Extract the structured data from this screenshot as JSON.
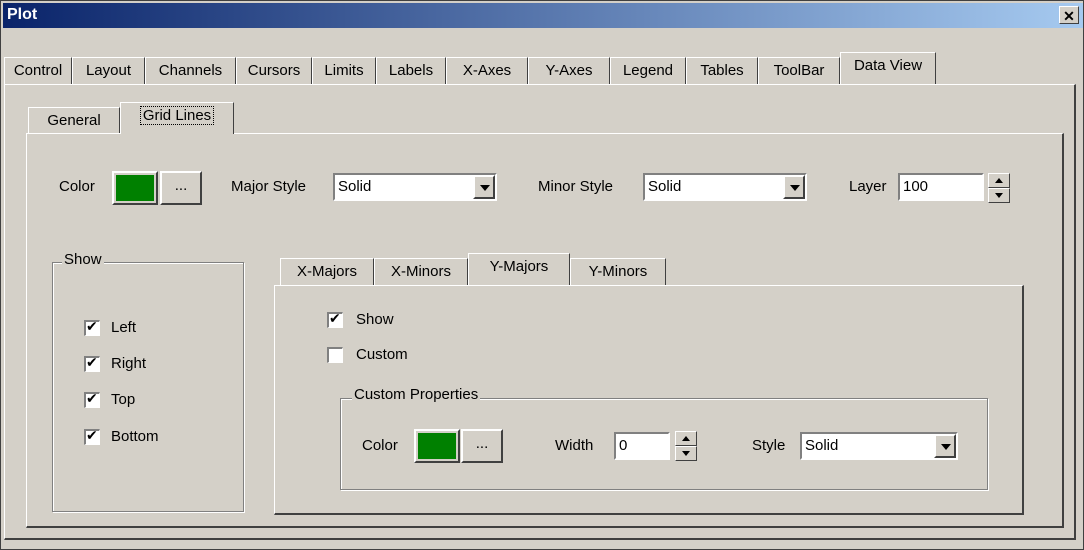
{
  "window": {
    "title": "Plot",
    "close_label": "✕"
  },
  "main_tabs": [
    "Control",
    "Layout",
    "Channels",
    "Cursors",
    "Limits",
    "Labels",
    "X-Axes",
    "Y-Axes",
    "Legend",
    "Tables",
    "ToolBar",
    "Data View"
  ],
  "selected_main_tab": "Data View",
  "sub_tabs": [
    "General",
    "Grid Lines"
  ],
  "selected_sub_tab": "Grid Lines",
  "grid_lines": {
    "color_label": "Color",
    "color_value": "#008000",
    "browse_label": "...",
    "major_style_label": "Major Style",
    "major_style_value": "Solid",
    "minor_style_label": "Minor Style",
    "minor_style_value": "Solid",
    "layer_label": "Layer",
    "layer_value": "100"
  },
  "show_group": {
    "title": "Show",
    "items": [
      {
        "label": "Left",
        "checked": true
      },
      {
        "label": "Right",
        "checked": true
      },
      {
        "label": "Top",
        "checked": true
      },
      {
        "label": "Bottom",
        "checked": true
      }
    ]
  },
  "axis_tabs": [
    "X-Majors",
    "X-Minors",
    "Y-Majors",
    "Y-Minors"
  ],
  "selected_axis_tab": "Y-Majors",
  "axis_panel": {
    "show_label": "Show",
    "show_checked": true,
    "custom_label": "Custom",
    "custom_checked": false,
    "custom_group_title": "Custom Properties",
    "color_label": "Color",
    "color_value": "#008000",
    "browse_label": "...",
    "width_label": "Width",
    "width_value": "0",
    "style_label": "Style",
    "style_value": "Solid"
  }
}
